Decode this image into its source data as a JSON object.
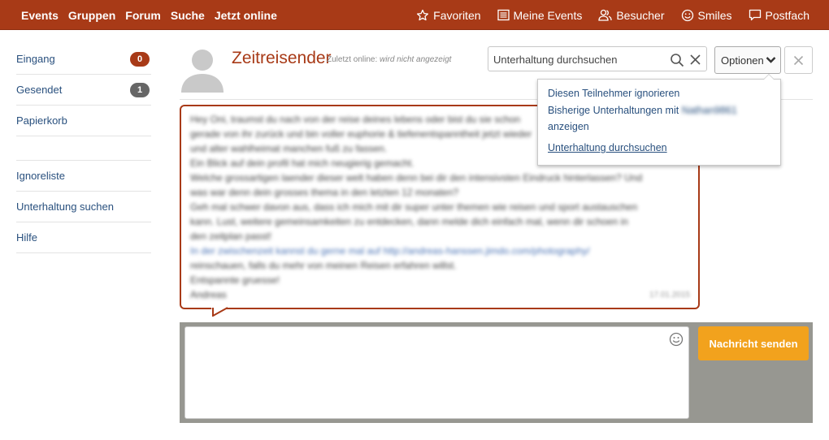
{
  "topnav": {
    "left": [
      "Events",
      "Gruppen",
      "Forum",
      "Suche",
      "Jetzt online"
    ],
    "right": [
      {
        "label": "Favoriten",
        "icon": "star-icon"
      },
      {
        "label": "Meine Events",
        "icon": "list-icon"
      },
      {
        "label": "Besucher",
        "icon": "users-icon"
      },
      {
        "label": "Smiles",
        "icon": "smiley-icon"
      },
      {
        "label": "Postfach",
        "icon": "chat-icon"
      }
    ]
  },
  "sidebar": {
    "items": [
      {
        "label": "Eingang",
        "badge": "0"
      },
      {
        "label": "Gesendet",
        "badge": "1"
      },
      {
        "label": "Papierkorb"
      }
    ],
    "items2": [
      {
        "label": "Ignoreliste"
      },
      {
        "label": "Unterhaltung suchen"
      },
      {
        "label": "Hilfe"
      }
    ]
  },
  "conversation": {
    "username": "Zeitreisender",
    "last_online_label": "Zuletzt online:",
    "last_online_value": "wird nicht angezeigt"
  },
  "search": {
    "placeholder": "Unterhaltung durchsuchen"
  },
  "options": {
    "label": "Optionen",
    "menu": {
      "ignore": "Diesen Teilnehmer ignorieren",
      "previous_line1": "Bisherige Unterhaltungen mit",
      "previous_name": "Nathan9861",
      "previous_line2": "anzeigen",
      "search": "Unterhaltung durchsuchen"
    }
  },
  "message": {
    "lines": [
      "Hey Oni, traumst du nach von der reise deines lebens oder bist du sie schon",
      "gerade von ihr zurück und bin voller euphorie & tiefenentspanntheit jetzt wieder",
      "und alter wahlheimat manchen fuß zu fassen.",
      "Ein Blick auf dein profil hat mich neugierig gemacht.",
      "Welche grossartigen laender dieser welt haben denn bei dir den intensivsten Eindruck hinterlassen? Und",
      "was war denn dein grosses thema in den letzten 12 monaten?",
      "Geh mal schwer davon aus, dass ich mich mit dir super unter themen wie reisen und sport austauschen",
      "kann. Lust, weitere gemeinsamkeiten zu entdecken, dann melde dich einfach mal, wenn dir schoen in",
      "den zeitplan passt!",
      "In der zwischenzeit kannst du gerne mal auf http://andreas-hanssen.jimdo.com/photography/",
      "reinschauen, falls du mehr von meinen Reisen erfahren willst.",
      "Entspannte gruesse!",
      "Andreas"
    ],
    "date": "17.01.2015"
  },
  "compose": {
    "send_label": "Nachricht senden"
  }
}
